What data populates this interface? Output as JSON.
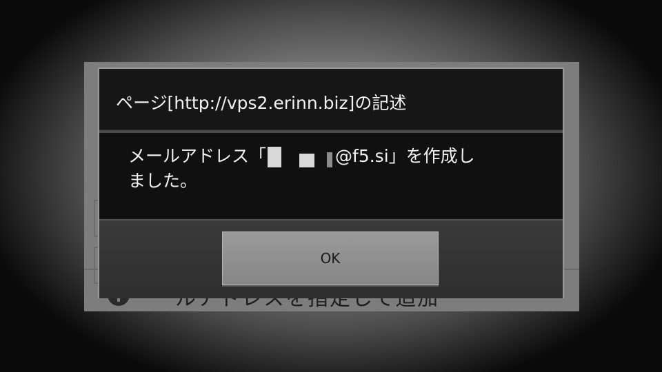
{
  "background": {
    "row_text": "ールアドレスを指定して追加"
  },
  "dialog": {
    "title": "ページ[http://vps2.erinn.biz]の記述",
    "message_line1_prefix": "メールアドレス「",
    "message_line1_suffix": "@f5.si」を作成し",
    "message_line2": "ました。",
    "ok_label": "OK"
  },
  "colors": {
    "dialog_bg": "#121212",
    "button_bg": "#8e8e8e",
    "text": "#f2f2f2"
  }
}
